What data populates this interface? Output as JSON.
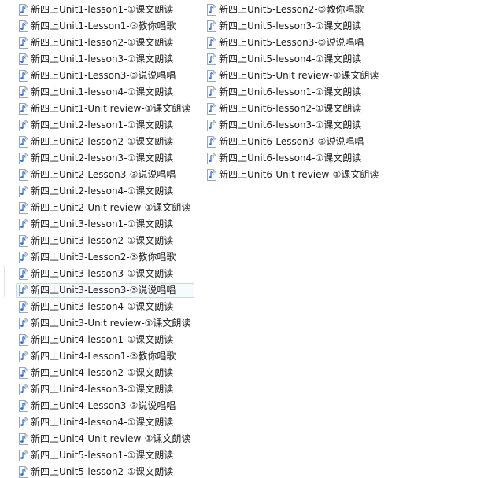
{
  "columns": [
    {
      "items": [
        {
          "name": "新四上Unit1-lesson1-①课文朗读"
        },
        {
          "name": "新四上Unit1-Lesson1-③教你唱歌"
        },
        {
          "name": "新四上Unit1-lesson2-①课文朗读"
        },
        {
          "name": "新四上Unit1-lesson3-①课文朗读"
        },
        {
          "name": "新四上Unit1-Lesson3-③说说唱唱"
        },
        {
          "name": "新四上Unit1-lesson4-①课文朗读"
        },
        {
          "name": "新四上Unit1-Unit review-①课文朗读"
        },
        {
          "name": "新四上Unit2-lesson1-①课文朗读"
        },
        {
          "name": "新四上Unit2-lesson2-①课文朗读"
        },
        {
          "name": "新四上Unit2-lesson3-①课文朗读"
        },
        {
          "name": "新四上Unit2-Lesson3-③说说唱唱"
        },
        {
          "name": "新四上Unit2-lesson4-①课文朗读"
        },
        {
          "name": "新四上Unit2-Unit review-①课文朗读"
        },
        {
          "name": "新四上Unit3-lesson1-①课文朗读"
        },
        {
          "name": "新四上Unit3-lesson2-①课文朗读"
        },
        {
          "name": "新四上Unit3-Lesson2-③教你唱歌"
        },
        {
          "name": "新四上Unit3-lesson3-①课文朗读"
        },
        {
          "name": "新四上Unit3-Lesson3-③说说唱唱",
          "highlighted": true
        },
        {
          "name": "新四上Unit3-lesson4-①课文朗读"
        },
        {
          "name": "新四上Unit3-Unit review-①课文朗读"
        },
        {
          "name": "新四上Unit4-lesson1-①课文朗读"
        },
        {
          "name": "新四上Unit4-Lesson1-③教你唱歌"
        },
        {
          "name": "新四上Unit4-lesson2-①课文朗读"
        },
        {
          "name": "新四上Unit4-lesson3-①课文朗读"
        },
        {
          "name": "新四上Unit4-Lesson3-③说说唱唱"
        },
        {
          "name": "新四上Unit4-lesson4-①课文朗读"
        },
        {
          "name": "新四上Unit4-Unit review-①课文朗读"
        },
        {
          "name": "新四上Unit5-lesson1-①课文朗读"
        },
        {
          "name": "新四上Unit5-lesson2-①课文朗读"
        }
      ]
    },
    {
      "items": [
        {
          "name": "新四上Unit5-Lesson2-③教你唱歌"
        },
        {
          "name": "新四上Unit5-lesson3-①课文朗读"
        },
        {
          "name": "新四上Unit5-Lesson3-③说说唱唱"
        },
        {
          "name": "新四上Unit5-lesson4-①课文朗读"
        },
        {
          "name": "新四上Unit5-Unit review-①课文朗读"
        },
        {
          "name": "新四上Unit6-lesson1-①课文朗读"
        },
        {
          "name": "新四上Unit6-lesson2-①课文朗读"
        },
        {
          "name": "新四上Unit6-lesson3-①课文朗读"
        },
        {
          "name": "新四上Unit6-Lesson3-③说说唱唱"
        },
        {
          "name": "新四上Unit6-lesson4-①课文朗读"
        },
        {
          "name": "新四上Unit6-Unit review-①课文朗读"
        }
      ]
    }
  ],
  "icon": {
    "name": "audio-file-icon",
    "note_color": "#2b6fd1",
    "page_color": "#ffffff",
    "border_color": "#9aa7b8"
  }
}
